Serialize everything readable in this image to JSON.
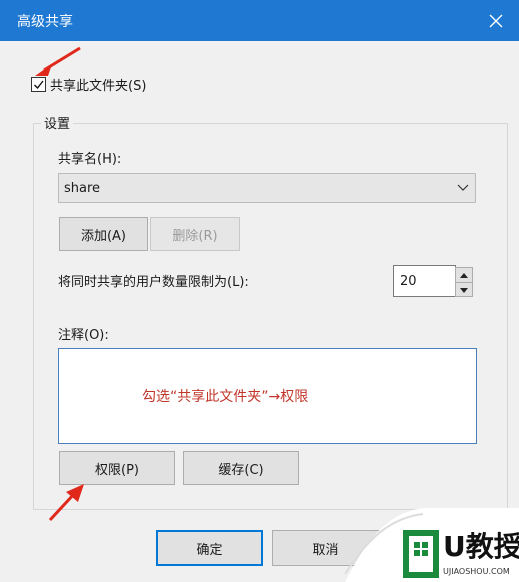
{
  "dialog": {
    "title": "高级共享"
  },
  "share_checkbox": {
    "label": "共享此文件夹(S)",
    "checked": true
  },
  "settings": {
    "group_label": "设置",
    "share_name_label": "共享名(H):",
    "share_name_value": "share",
    "add_button": "添加(A)",
    "remove_button": "删除(R)",
    "user_limit_label": "将同时共享的用户数量限制为(L):",
    "user_limit_value": "20",
    "comment_label": "注释(O):",
    "permissions_button": "权限(P)",
    "caching_button": "缓存(C)"
  },
  "annotation": {
    "text": "勾选“共享此文件夹”→权限",
    "color": "#c2352a"
  },
  "footer": {
    "ok_button": "确定",
    "cancel_button": "取消"
  },
  "watermark": {
    "brand": "U教授",
    "url": "UJIAOSHOU.COM"
  },
  "colors": {
    "titlebar": "#1f78d1",
    "arrow": "#e0281b",
    "focus": "#4a7fc1"
  }
}
